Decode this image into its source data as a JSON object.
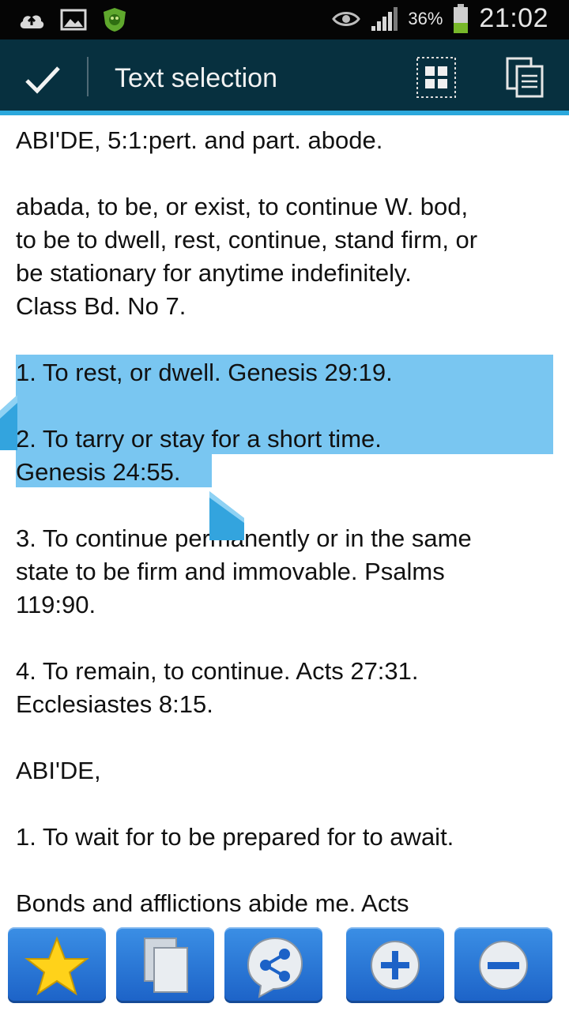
{
  "status_bar": {
    "battery_percent": "36%",
    "time": "21:02",
    "icons": [
      "cloud-upload-icon",
      "gallery-icon",
      "shield-app-icon",
      "eye-icon",
      "signal-icon",
      "battery-icon"
    ]
  },
  "action_bar": {
    "title": "Text selection",
    "accent_color": "#2ba8dc",
    "background_color": "#07303f"
  },
  "content": {
    "lines": [
      "ABI'DE, 5:1:pert. and part. abode.",
      "abada, to be, or exist, to continue W. bod,",
      "to be to dwell, rest, continue, stand firm, or",
      "be stationary for anytime indefinitely.",
      "Class Bd. No 7.",
      "1. To rest, or dwell. Genesis 29:19.",
      "2. To tarry or stay for a short time.",
      "Genesis 24:55.",
      "3. To continue permanently or in the same",
      "state to be firm and immovable. Psalms",
      "119:90.",
      "4. To remain, to continue. Acts 27:31.",
      "Ecclesiastes 8:15.",
      "ABI'DE,",
      "1. To wait for to be prepared for to await.",
      "Bonds and afflictions abide me. Acts"
    ],
    "selection_color": "#79c6f1"
  },
  "toolbar": {
    "buttons": [
      "star-icon",
      "copy-pages-icon",
      "share-icon",
      "zoom-in-icon",
      "zoom-out-icon"
    ]
  }
}
